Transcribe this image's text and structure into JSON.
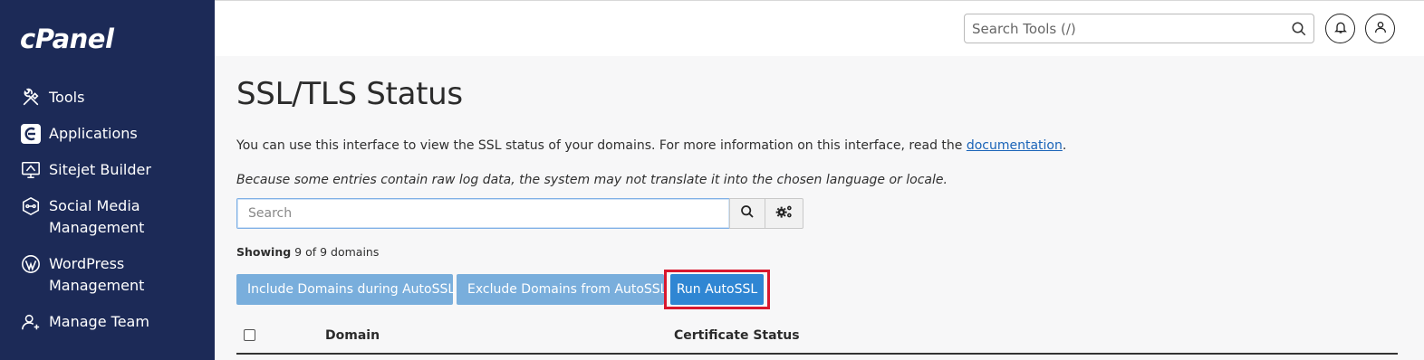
{
  "sidebar": {
    "logo": "cPanel",
    "items": [
      {
        "label": "Tools",
        "icon": "tools-icon"
      },
      {
        "label": "Applications",
        "icon": "applications-icon"
      },
      {
        "label": "Sitejet Builder",
        "icon": "sitejet-icon"
      },
      {
        "label": "Social Media Management",
        "icon": "social-media-icon"
      },
      {
        "label": "WordPress Management",
        "icon": "wordpress-icon"
      },
      {
        "label": "Manage Team",
        "icon": "manage-team-icon"
      }
    ]
  },
  "header": {
    "search_placeholder": "Search Tools (/)"
  },
  "main": {
    "title": "SSL/TLS Status",
    "description_text": "You can use this interface to view the SSL status of your domains. For more information on this interface, read the ",
    "description_link": "documentation",
    "description_end": ".",
    "note": "Because some entries contain raw log data, the system may not translate it into the chosen language or locale.",
    "filter_placeholder": "Search",
    "showing_label": "Showing",
    "showing_count": "9 of 9 domains",
    "buttons": {
      "include": "Include Domains during AutoSSL",
      "exclude": "Exclude Domains from AutoSSL",
      "run": "Run AutoSSL"
    },
    "table": {
      "columns": [
        "Domain",
        "Certificate Status"
      ]
    }
  },
  "colors": {
    "sidebar_bg": "#1c2a57",
    "primary_button": "#2f86d3",
    "secondary_button": "#79aedc",
    "highlight_border": "#d8182e",
    "link": "#1a64b8"
  }
}
